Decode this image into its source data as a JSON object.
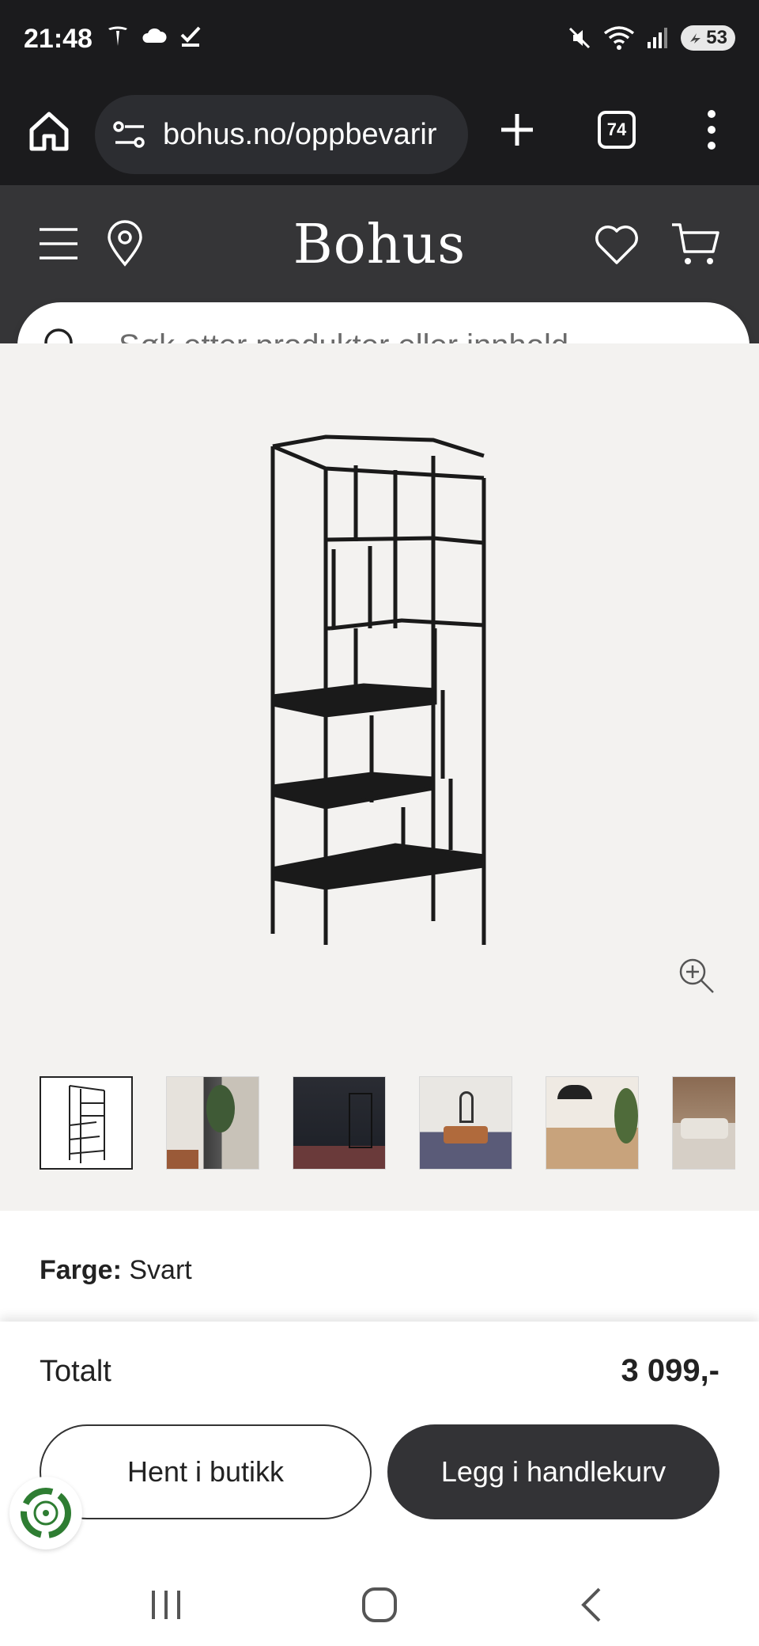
{
  "status_bar": {
    "time": "21:48",
    "battery": "53",
    "left_icons": [
      "tesla-icon",
      "cloud-icon",
      "check-icon"
    ],
    "right_icons": [
      "mute-icon",
      "wifi-icon",
      "signal-icon",
      "battery-icon"
    ]
  },
  "browser": {
    "url": "bohus.no/oppbevarir",
    "tab_count": "74",
    "icons": [
      "home-icon",
      "site-settings-icon",
      "plus-icon",
      "tabs-icon",
      "more-vert-icon"
    ]
  },
  "site": {
    "logo": "Bohus",
    "search_placeholder": "Søk etter produkter eller innhold ...",
    "icons": [
      "menu-icon",
      "location-pin-icon",
      "heart-icon",
      "cart-icon",
      "search-icon"
    ]
  },
  "product": {
    "color_label": "Farge:",
    "color_value": "Svart",
    "thumbnail_count": 6,
    "selected_thumbnail": 1,
    "icons": [
      "zoom-in-icon"
    ]
  },
  "purchase": {
    "total_label": "Totalt",
    "total_price": "3 099,-",
    "pickup_button": "Hent i butikk",
    "add_to_cart_button": "Legg i handlekurv",
    "icons": [
      "eco-icon"
    ]
  },
  "nav_bar": {
    "icons": [
      "recents-icon",
      "home-circle-icon",
      "back-icon"
    ]
  },
  "colors": {
    "status_bg": "#1b1b1d",
    "header_bg": "#353537",
    "page_bg": "#f3f2f0",
    "dark_button": "#333336",
    "eco_green": "#2e7d32"
  }
}
